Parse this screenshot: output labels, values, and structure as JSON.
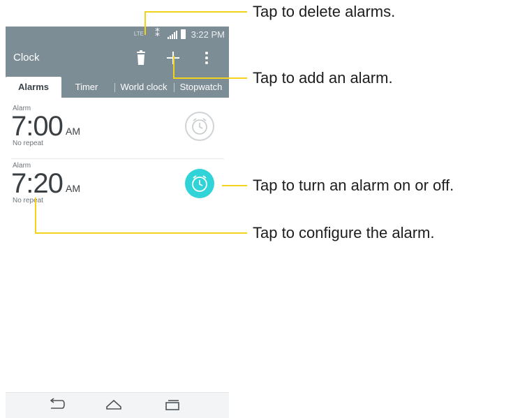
{
  "status_bar": {
    "network": "LTE",
    "time": "3:22 PM"
  },
  "app": {
    "title": "Clock"
  },
  "actions": {
    "delete_icon": "trash-icon",
    "add_icon": "plus-icon",
    "menu_icon": "overflow-menu-icon"
  },
  "tabs": [
    {
      "label": "Alarms",
      "active": true
    },
    {
      "label": "Timer",
      "active": false
    },
    {
      "label": "World clock",
      "active": false
    },
    {
      "label": "Stopwatch",
      "active": false
    }
  ],
  "alarms": [
    {
      "label": "Alarm",
      "time": "7:00",
      "ampm": "AM",
      "repeat": "No repeat",
      "enabled": false
    },
    {
      "label": "Alarm",
      "time": "7:20",
      "ampm": "AM",
      "repeat": "No repeat",
      "enabled": true
    }
  ],
  "nav": {
    "back_icon": "back-icon",
    "home_icon": "home-icon",
    "recents_icon": "recents-icon"
  },
  "callouts": {
    "delete": "Tap to delete alarms.",
    "add": "Tap to add an alarm.",
    "toggle": "Tap to turn an alarm on or off.",
    "configure": "Tap to configure the alarm."
  },
  "colors": {
    "action_bar": "#7d8d96",
    "toggle_on": "#2fd3d8",
    "callout_line": "#f3d21c"
  }
}
